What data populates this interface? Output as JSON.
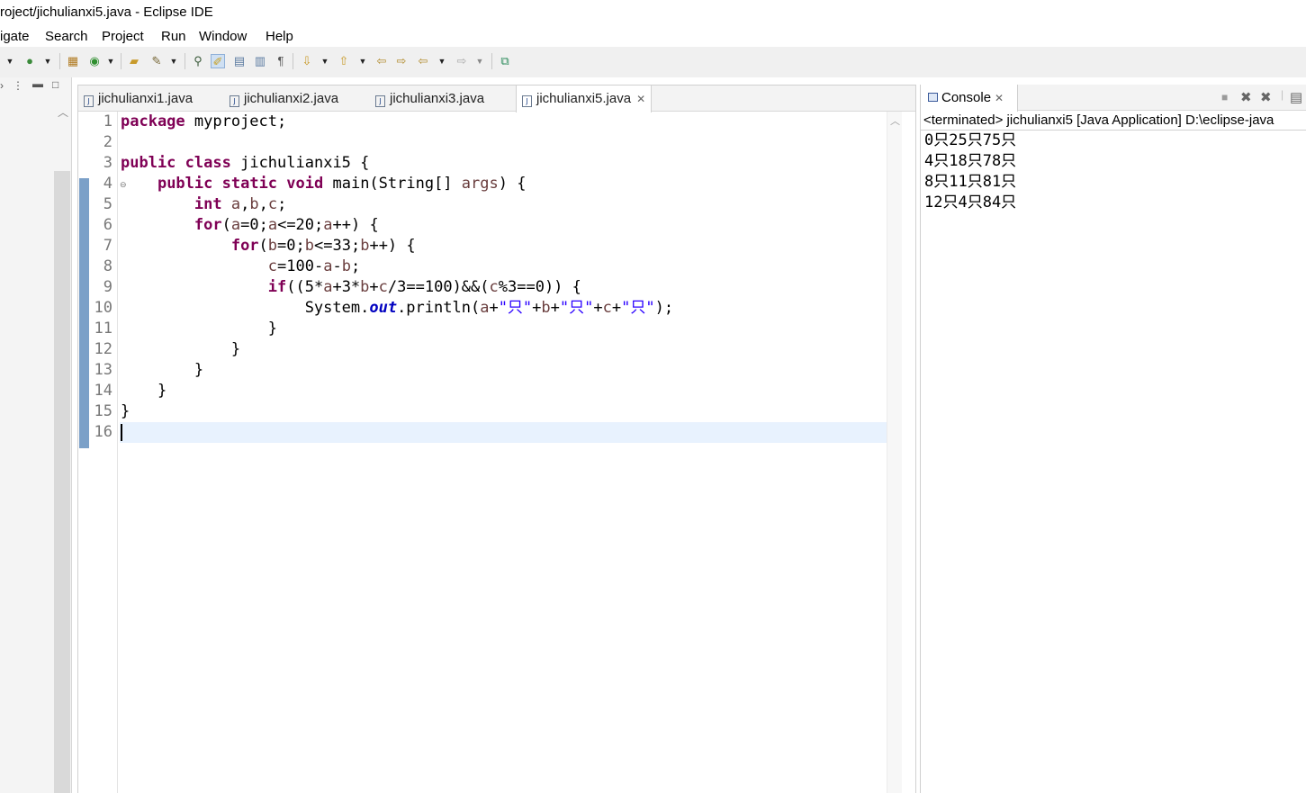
{
  "window": {
    "title": "roject/jichulianxi5.java - Eclipse IDE"
  },
  "menu": [
    "igate",
    "Search",
    "Project",
    "Run",
    "Window",
    "Help"
  ],
  "toolbar_icons": [
    "new-dropdown-icon",
    "run-dropdown-icon",
    "new-package-icon",
    "new-class-icon",
    "open-type-icon",
    "search-icon",
    "toggle-mark-occurrences-icon",
    "toggle-highlight-icon",
    "block-selection-icon",
    "show-whitespace-icon",
    "next-annotation-icon",
    "previous-annotation-icon",
    "last-edit-icon",
    "back-icon",
    "forward-icon",
    "pin-editor-icon"
  ],
  "editor": {
    "tabs": [
      {
        "label": "jichulianxi1.java",
        "active": false
      },
      {
        "label": "jichulianxi2.java",
        "active": false
      },
      {
        "label": "jichulianxi3.java",
        "active": false
      },
      {
        "label": "jichulianxi5.java",
        "active": true
      }
    ],
    "line_numbers": [
      "1",
      "2",
      "3",
      "4",
      "5",
      "6",
      "7",
      "8",
      "9",
      "10",
      "11",
      "12",
      "13",
      "14",
      "15",
      "16"
    ],
    "fold_marker_line": "4",
    "current_line": "16",
    "code_lines": [
      "package myproject;",
      "",
      "public class jichulianxi5 {",
      "    public static void main(String[] args) {",
      "        int a,b,c;",
      "        for(a=0;a<=20;a++) {",
      "            for(b=0;b<=33;b++) {",
      "                c=100-a-b;",
      "                if((5*a+3*b+c/3==100)&&(c%3==0)) {",
      "                    System.out.println(a+\"只\"+b+\"只\"+c+\"只\");",
      "                }",
      "            }",
      "        }",
      "    }",
      "}",
      ""
    ]
  },
  "console": {
    "tab_label": "Console",
    "status": "<terminated> jichulianxi5 [Java Application] D:\\eclipse-java",
    "output": [
      "0只25只75只",
      "4只18只78只",
      "8只11只81只",
      "12只4只84只"
    ]
  },
  "colors": {
    "keyword": "#7f0055",
    "string": "#2a00ff",
    "field": "#0000c0",
    "variable": "#6a3e3e",
    "current_line": "#e8f2fe",
    "change_bar": "#7ba0c8"
  }
}
